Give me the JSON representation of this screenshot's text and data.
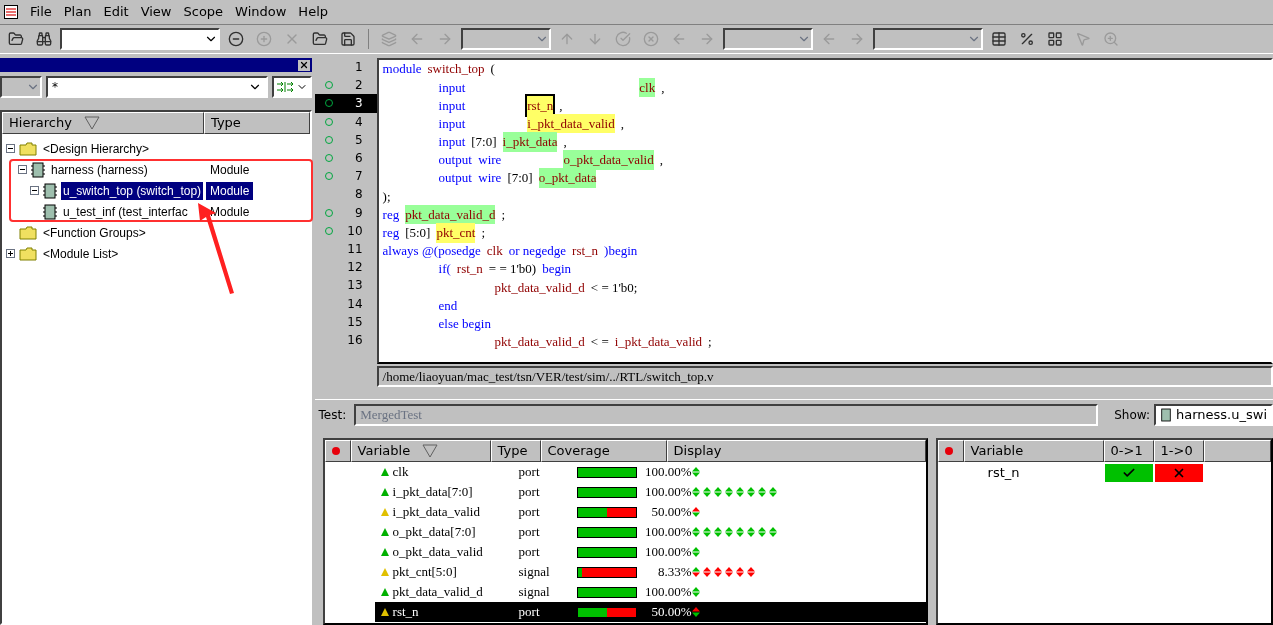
{
  "menu": [
    "File",
    "Plan",
    "Edit",
    "View",
    "Scope",
    "Window",
    "Help"
  ],
  "hierarchy": {
    "filter": "*",
    "columns": [
      "Hierarchy",
      "Type"
    ],
    "tree": [
      {
        "label": "<Design Hierarchy>",
        "kind": "folder",
        "expanded": true,
        "selected": false,
        "children": [
          {
            "label": "harness (harness)",
            "type": "Module",
            "kind": "module",
            "expanded": true,
            "selected": false,
            "children": [
              {
                "label": "u_switch_top (switch_top)",
                "type": "Module",
                "kind": "module",
                "expanded": true,
                "selected": true
              },
              {
                "label": "u_test_inf (test_interfac",
                "type": "Module",
                "kind": "module",
                "selected": false
              }
            ]
          }
        ]
      },
      {
        "label": "<Function Groups>",
        "kind": "folder",
        "selected": false
      },
      {
        "label": "<Module List>",
        "kind": "folder",
        "expanded": false,
        "selected": false
      }
    ]
  },
  "code": {
    "lines": [
      {
        "number": "1",
        "covered": false,
        "selected": false,
        "tokens": [
          {
            "kind": "kw",
            "text": "module"
          },
          {
            "kind": "id",
            "text": "switch_top"
          },
          {
            "kind": "plain",
            "text": "("
          }
        ]
      },
      {
        "number": "2",
        "covered": true,
        "selected": false,
        "tokens": [
          {
            "kind": "tab"
          },
          {
            "kind": "kw",
            "text": "input"
          },
          {
            "kind": "tab"
          },
          {
            "kind": "tab"
          },
          {
            "kind": "tab"
          },
          {
            "kind": "id",
            "text": "clk",
            "color": "#99ff99"
          },
          {
            "kind": "plain",
            "text": ","
          }
        ]
      },
      {
        "number": "3",
        "covered": true,
        "selected": true,
        "tokens": [
          {
            "kind": "tab"
          },
          {
            "kind": "kw",
            "text": "input"
          },
          {
            "kind": "tab"
          },
          {
            "kind": "id",
            "text": "rst_n",
            "color": "#ffff66",
            "cursor": true
          },
          {
            "kind": "plain",
            "text": ","
          }
        ]
      },
      {
        "number": "4",
        "covered": true,
        "selected": false,
        "tokens": [
          {
            "kind": "tab"
          },
          {
            "kind": "kw",
            "text": "input"
          },
          {
            "kind": "tab"
          },
          {
            "kind": "id",
            "text": "i_pkt_data_valid",
            "color": "#ffff66"
          },
          {
            "kind": "plain",
            "text": ","
          }
        ]
      },
      {
        "number": "5",
        "covered": true,
        "selected": false,
        "tokens": [
          {
            "kind": "tab"
          },
          {
            "kind": "kw",
            "text": "input"
          },
          {
            "kind": "plain",
            "text": "[7:0]"
          },
          {
            "kind": "id",
            "text": "i_pkt_data",
            "color": "#99ff99"
          },
          {
            "kind": "plain",
            "text": ","
          }
        ]
      },
      {
        "number": "6",
        "covered": true,
        "selected": false,
        "tokens": [
          {
            "kind": "tab"
          },
          {
            "kind": "kw",
            "text": "output  wire"
          },
          {
            "kind": "tab"
          },
          {
            "kind": "id",
            "text": "o_pkt_data_valid",
            "color": "#99ff99"
          },
          {
            "kind": "plain",
            "text": ","
          }
        ]
      },
      {
        "number": "7",
        "covered": true,
        "selected": false,
        "tokens": [
          {
            "kind": "tab"
          },
          {
            "kind": "kw",
            "text": "output  wire"
          },
          {
            "kind": "plain",
            "text": "[7:0]"
          },
          {
            "kind": "id",
            "text": "o_pkt_data",
            "color": "#99ff99"
          }
        ]
      },
      {
        "number": "8",
        "covered": false,
        "selected": false,
        "tokens": [
          {
            "kind": "plain",
            "text": ");"
          }
        ]
      },
      {
        "number": "9",
        "covered": true,
        "selected": false,
        "tokens": [
          {
            "kind": "kw",
            "text": "reg"
          },
          {
            "kind": "id",
            "text": "pkt_data_valid_d",
            "color": "#99ff99"
          },
          {
            "kind": "plain",
            "text": ";"
          }
        ]
      },
      {
        "number": "10",
        "covered": true,
        "selected": false,
        "tokens": [
          {
            "kind": "kw",
            "text": "reg"
          },
          {
            "kind": "plain",
            "text": "[5:0]"
          },
          {
            "kind": "id",
            "text": "pkt_cnt",
            "color": "#ffff66"
          },
          {
            "kind": "plain",
            "text": ";"
          }
        ]
      },
      {
        "number": "11",
        "covered": false,
        "selected": false,
        "tokens": [
          {
            "kind": "kw",
            "text": "always @(posedge"
          },
          {
            "kind": "id",
            "text": "clk"
          },
          {
            "kind": "kw",
            "text": "or negedge"
          },
          {
            "kind": "id",
            "text": "rst_n"
          },
          {
            "kind": "kw",
            "text": ")begin"
          }
        ]
      },
      {
        "number": "12",
        "covered": false,
        "selected": false,
        "tokens": [
          {
            "kind": "tab"
          },
          {
            "kind": "kw",
            "text": "if("
          },
          {
            "kind": "id",
            "text": "rst_n"
          },
          {
            "kind": "plain",
            "text": "= = 1'b0)"
          },
          {
            "kind": "kw",
            "text": "begin"
          }
        ]
      },
      {
        "number": "13",
        "covered": false,
        "selected": false,
        "tokens": [
          {
            "kind": "tab"
          },
          {
            "kind": "tab"
          },
          {
            "kind": "id",
            "text": "pkt_data_valid_d"
          },
          {
            "kind": "plain",
            "text": "< = 1'b0;"
          }
        ]
      },
      {
        "number": "14",
        "covered": false,
        "selected": false,
        "tokens": [
          {
            "kind": "tab"
          },
          {
            "kind": "kw",
            "text": "end"
          }
        ]
      },
      {
        "number": "15",
        "covered": false,
        "selected": false,
        "tokens": [
          {
            "kind": "tab"
          },
          {
            "kind": "kw",
            "text": "else begin"
          }
        ]
      },
      {
        "number": "16",
        "covered": false,
        "selected": false,
        "tokens": [
          {
            "kind": "tab"
          },
          {
            "kind": "tab"
          },
          {
            "kind": "id",
            "text": "pkt_data_valid_d"
          },
          {
            "kind": "plain",
            "text": "< ="
          },
          {
            "kind": "id",
            "text": "i_pkt_data_valid"
          },
          {
            "kind": "plain",
            "text": ";"
          }
        ]
      }
    ],
    "path": "/home/liaoyuan/mac_test/tsn/VER/test/sim/../RTL/switch_top.v"
  },
  "test": {
    "label": "Test:",
    "value": "MergedTest"
  },
  "show": {
    "label": "Show:",
    "value": "harness.u_swi"
  },
  "variables": {
    "columns": [
      "Variable",
      "Type",
      "Coverage",
      "Display"
    ],
    "rows": [
      {
        "name": "clk",
        "full": true,
        "type": "port",
        "level": 1,
        "percent": "100.00%",
        "selected": false,
        "bits": [
          {
            "rise": true,
            "fall": true
          }
        ]
      },
      {
        "name": "i_pkt_data[7:0]",
        "full": true,
        "type": "port",
        "level": 1,
        "percent": "100.00%",
        "selected": false,
        "bits": [
          {
            "rise": true,
            "fall": true
          },
          {
            "rise": true,
            "fall": true
          },
          {
            "rise": true,
            "fall": true
          },
          {
            "rise": true,
            "fall": true
          },
          {
            "rise": true,
            "fall": true
          },
          {
            "rise": true,
            "fall": true
          },
          {
            "rise": true,
            "fall": true
          },
          {
            "rise": true,
            "fall": true
          }
        ]
      },
      {
        "name": "i_pkt_data_valid",
        "full": false,
        "type": "port",
        "level": 0.5,
        "percent": "50.00%",
        "selected": false,
        "bits": [
          {
            "rise": false,
            "fall": true
          }
        ]
      },
      {
        "name": "o_pkt_data[7:0]",
        "full": true,
        "type": "port",
        "level": 1,
        "percent": "100.00%",
        "selected": false,
        "bits": [
          {
            "rise": true,
            "fall": true
          },
          {
            "rise": true,
            "fall": true
          },
          {
            "rise": true,
            "fall": true
          },
          {
            "rise": true,
            "fall": true
          },
          {
            "rise": true,
            "fall": true
          },
          {
            "rise": true,
            "fall": true
          },
          {
            "rise": true,
            "fall": true
          },
          {
            "rise": true,
            "fall": true
          }
        ]
      },
      {
        "name": "o_pkt_data_valid",
        "full": true,
        "type": "port",
        "level": 1,
        "percent": "100.00%",
        "selected": false,
        "bits": [
          {
            "rise": true,
            "fall": true
          }
        ]
      },
      {
        "name": "pkt_cnt[5:0]",
        "full": false,
        "type": "signal",
        "level": 0.0833,
        "percent": "8.33%",
        "selected": false,
        "bits": [
          {
            "rise": true,
            "fall": false
          },
          {
            "rise": false,
            "fall": false
          },
          {
            "rise": false,
            "fall": false
          },
          {
            "rise": false,
            "fall": false
          },
          {
            "rise": false,
            "fall": false
          },
          {
            "rise": false,
            "fall": false
          }
        ]
      },
      {
        "name": "pkt_data_valid_d",
        "full": true,
        "type": "signal",
        "level": 1,
        "percent": "100.00%",
        "selected": false,
        "bits": [
          {
            "rise": true,
            "fall": true
          }
        ]
      },
      {
        "name": "rst_n",
        "full": false,
        "type": "port",
        "level": 0.5,
        "percent": "50.00%",
        "selected": true,
        "bits": [
          {
            "rise": false,
            "fall": true
          }
        ]
      }
    ]
  },
  "toggles": {
    "columns": [
      "Variable",
      "0->1",
      "1->0"
    ],
    "rows": [
      {
        "name": "rst_n",
        "rise": true,
        "fall": false
      }
    ]
  }
}
